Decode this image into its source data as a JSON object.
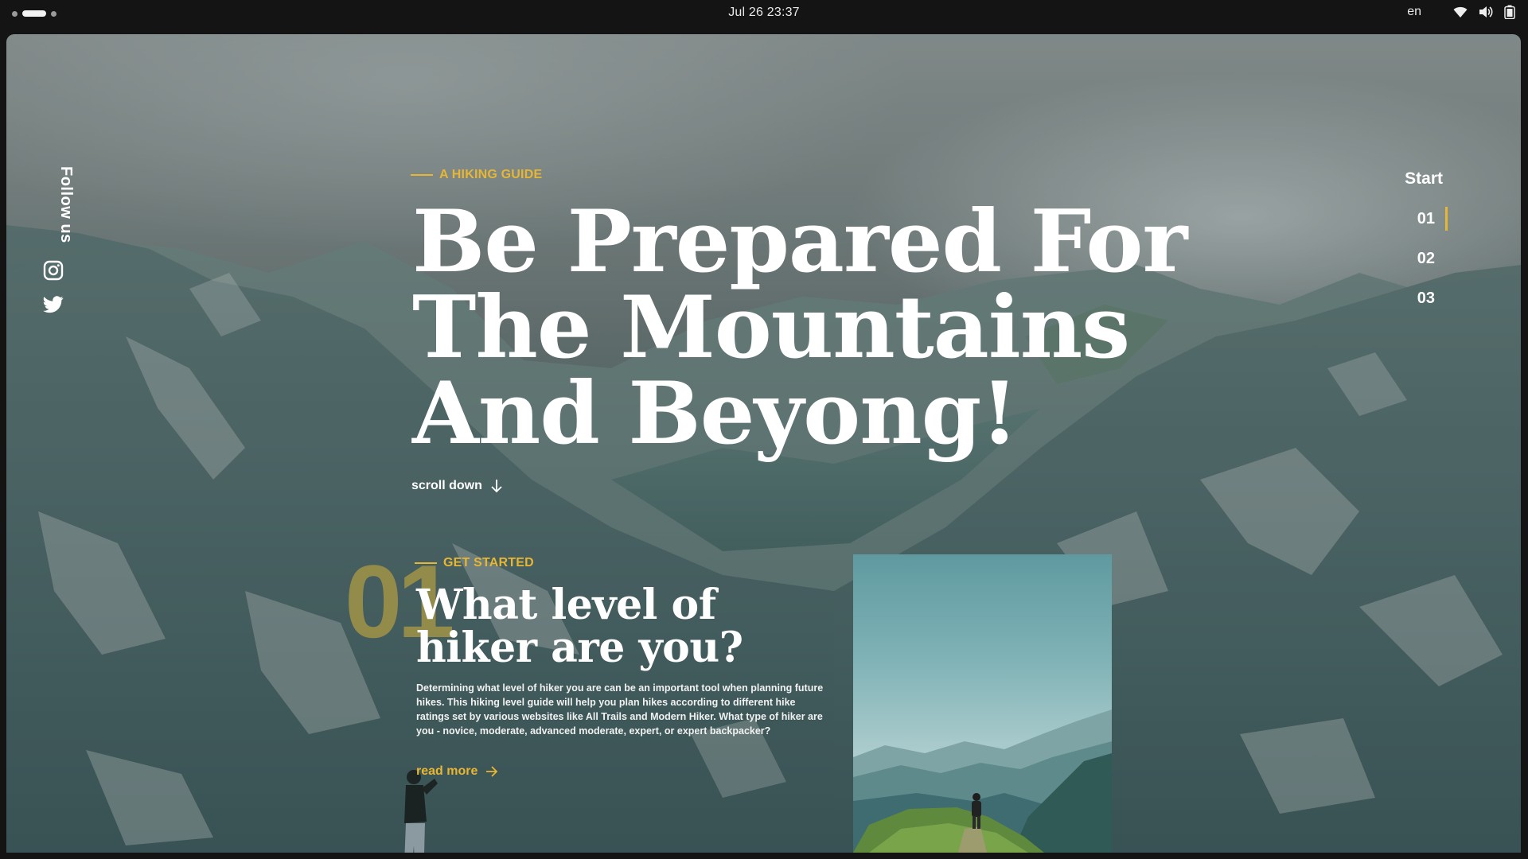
{
  "system_bar": {
    "clock": "Jul 26  23:37",
    "language": "en",
    "icons": [
      "wifi-icon",
      "volume-icon",
      "battery-icon"
    ]
  },
  "social": {
    "label": "Follow us",
    "icons": [
      "instagram-icon",
      "twitter-icon"
    ]
  },
  "hero": {
    "eyebrow": "A HIKING GUIDE",
    "title_lines": [
      "Be Prepared For",
      "The Mountains",
      "And Beyong!"
    ],
    "scroll_label": "scroll down"
  },
  "side_nav": {
    "start": "Start",
    "items": [
      "01",
      "02",
      "03"
    ],
    "active_index": 0
  },
  "section": {
    "number": "01",
    "eyebrow": "GET STARTED",
    "title_lines": [
      "What level of",
      "hiker are you?"
    ],
    "body": "Determining what level of hiker you are can be an important tool when planning future hikes. This hiking level guide will help you plan hikes according to different hike ratings set by various websites like All Trails and Modern Hiker. What type of hiker are you - novice, moderate, advanced moderate, expert, or expert backpacker?",
    "link": "read more"
  },
  "colors": {
    "accent": "#e7b632",
    "text": "#ffffff",
    "topbar": "#141414"
  }
}
